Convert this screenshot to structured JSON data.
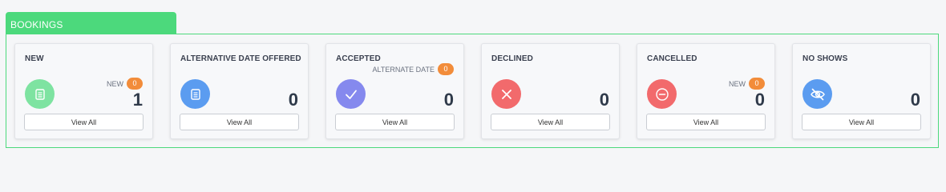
{
  "section": {
    "title": "BOOKINGS",
    "accent": "#4cd97c"
  },
  "cards": [
    {
      "title": "NEW",
      "count": "1",
      "sub_label": "NEW",
      "badge": "0",
      "button": "View All",
      "icon": "clipboard-icon",
      "icon_color": "#7ee3a1"
    },
    {
      "title": "ALTERNATIVE DATE OFFERED",
      "count": "0",
      "button": "View All",
      "icon": "clipboard-icon",
      "icon_color": "#5b9cf0"
    },
    {
      "title": "ACCEPTED",
      "count": "0",
      "sub_label": "ALTERNATE DATE",
      "badge": "0",
      "button": "View All",
      "icon": "check-icon",
      "icon_color": "#8589ee"
    },
    {
      "title": "DECLINED",
      "count": "0",
      "button": "View All",
      "icon": "close-icon",
      "icon_color": "#f26a6c"
    },
    {
      "title": "CANCELLED",
      "count": "0",
      "sub_label": "NEW",
      "badge": "0",
      "button": "View All",
      "icon": "minus-circle-icon",
      "icon_color": "#f26a6c"
    },
    {
      "title": "NO SHOWS",
      "count": "0",
      "button": "View All",
      "icon": "eye-off-icon",
      "icon_color": "#5b9cf0"
    }
  ],
  "badge_color": "#f28c3a"
}
